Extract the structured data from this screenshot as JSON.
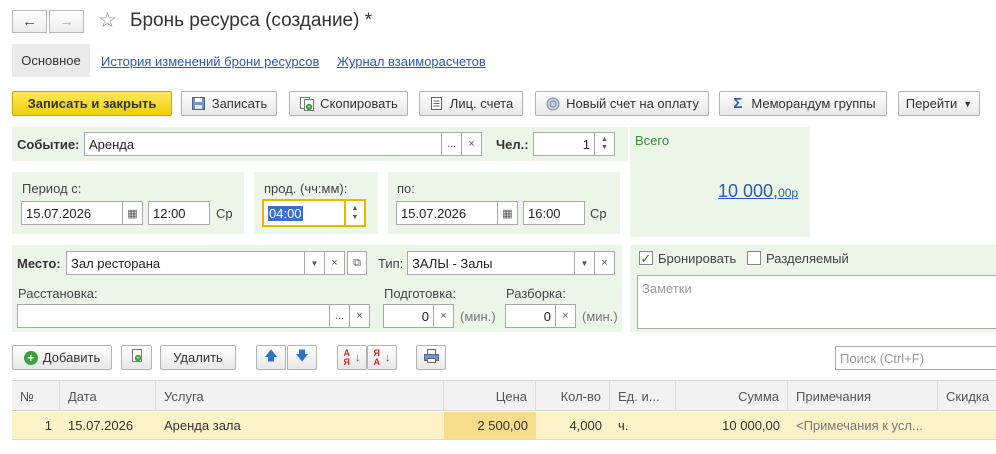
{
  "header": {
    "title": "Бронь ресурса (создание) *"
  },
  "tabs": [
    {
      "label": "Основное"
    },
    {
      "label": "История изменений брони ресурсов"
    },
    {
      "label": "Журнал взаиморасчетов"
    }
  ],
  "toolbar": {
    "write_close": "Записать и закрыть",
    "write": "Записать",
    "copy": "Скопировать",
    "accounts": "Лиц. счета",
    "new_invoice": "Новый счет на оплату",
    "memo": "Меморандум группы",
    "goto": "Перейти"
  },
  "form": {
    "event_label": "Событие:",
    "event_value": "Аренда",
    "persons_label": "Чел.:",
    "persons_value": "1",
    "period_from_label": "Период с:",
    "date_from": "15.07.2026",
    "time_from": "12:00",
    "day_from": "Ср",
    "duration_label": "прод. (чч:мм):",
    "duration_value": "04:00",
    "to_label": "по:",
    "date_to": "15.07.2026",
    "time_to": "16:00",
    "day_to": "Ср",
    "place_label": "Место:",
    "place_value": "Зал ресторана",
    "type_label": "Тип:",
    "type_value": "ЗАЛЫ - Залы",
    "arrangement_label": "Расстановка:",
    "arrangement_value": "",
    "prep_label": "Подготовка:",
    "prep_value": "0",
    "prep_unit": "(мин.)",
    "teardown_label": "Разборка:",
    "teardown_value": "0",
    "teardown_unit": "(мин.)"
  },
  "total": {
    "label": "Всего",
    "amount": "10 000,",
    "cents": "00",
    "currency": "р"
  },
  "options": {
    "book_label": "Бронировать",
    "book_checked": true,
    "shared_label": "Разделяемый",
    "shared_checked": false,
    "notes_placeholder": "Заметки"
  },
  "table_toolbar": {
    "add": "Добавить",
    "delete": "Удалить",
    "search_placeholder": "Поиск (Ctrl+F)"
  },
  "table": {
    "columns": [
      "№",
      "Дата",
      "Услуга",
      "Цена",
      "Кол-во",
      "Ед. и...",
      "Сумма",
      "Примечания",
      "Скидка"
    ],
    "rows": [
      {
        "num": "1",
        "date": "15.07.2026",
        "service": "Аренда зала",
        "price": "2 500,00",
        "qty": "4,000",
        "unit": "ч.",
        "sum": "10 000,00",
        "notes": "<Примечания к усл...",
        "discount": ""
      }
    ]
  }
}
